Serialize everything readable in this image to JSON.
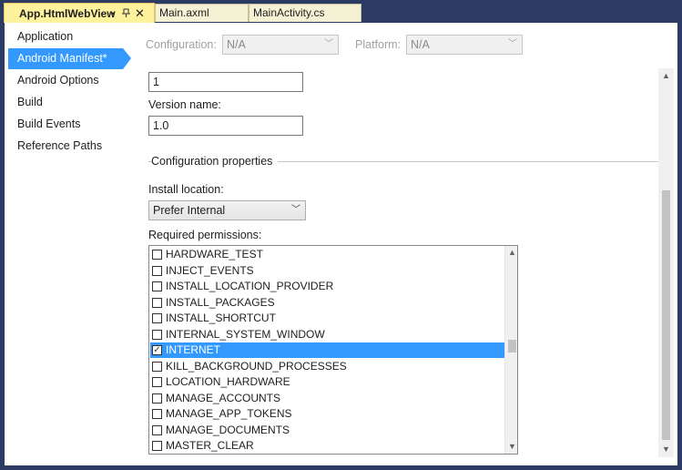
{
  "tabs": [
    {
      "label": "App.HtmlWebView",
      "active": true,
      "modified_marker": "•",
      "pin_icon": "pin-icon",
      "close_label": "✕"
    },
    {
      "label": "Main.axml",
      "active": false
    },
    {
      "label": "MainActivity.cs",
      "active": false
    }
  ],
  "sidebar": {
    "items": [
      {
        "label": "Application"
      },
      {
        "label": "Android Manifest*",
        "selected": true
      },
      {
        "label": "Android Options"
      },
      {
        "label": "Build"
      },
      {
        "label": "Build Events"
      },
      {
        "label": "Reference Paths"
      }
    ]
  },
  "config_bar": {
    "configuration_label": "Configuration:",
    "configuration_value": "N/A",
    "platform_label": "Platform:",
    "platform_value": "N/A"
  },
  "form": {
    "version_number_value": "1",
    "version_name_label": "Version name:",
    "version_name_value": "1.0",
    "group_title": "Configuration properties",
    "install_location_label": "Install location:",
    "install_location_value": "Prefer Internal",
    "required_permissions_label": "Required permissions:"
  },
  "permissions": [
    {
      "name": "HARDWARE_TEST",
      "checked": false
    },
    {
      "name": "INJECT_EVENTS",
      "checked": false
    },
    {
      "name": "INSTALL_LOCATION_PROVIDER",
      "checked": false
    },
    {
      "name": "INSTALL_PACKAGES",
      "checked": false
    },
    {
      "name": "INSTALL_SHORTCUT",
      "checked": false
    },
    {
      "name": "INTERNAL_SYSTEM_WINDOW",
      "checked": false
    },
    {
      "name": "INTERNET",
      "checked": true,
      "selected": true
    },
    {
      "name": "KILL_BACKGROUND_PROCESSES",
      "checked": false
    },
    {
      "name": "LOCATION_HARDWARE",
      "checked": false
    },
    {
      "name": "MANAGE_ACCOUNTS",
      "checked": false
    },
    {
      "name": "MANAGE_APP_TOKENS",
      "checked": false
    },
    {
      "name": "MANAGE_DOCUMENTS",
      "checked": false
    },
    {
      "name": "MASTER_CLEAR",
      "checked": false
    }
  ],
  "colors": {
    "tab_active_bg": "#fff29d",
    "tab_inactive_bg": "#f5f1d4",
    "frame_bg": "#2b3b63",
    "selection": "#3399ff"
  }
}
